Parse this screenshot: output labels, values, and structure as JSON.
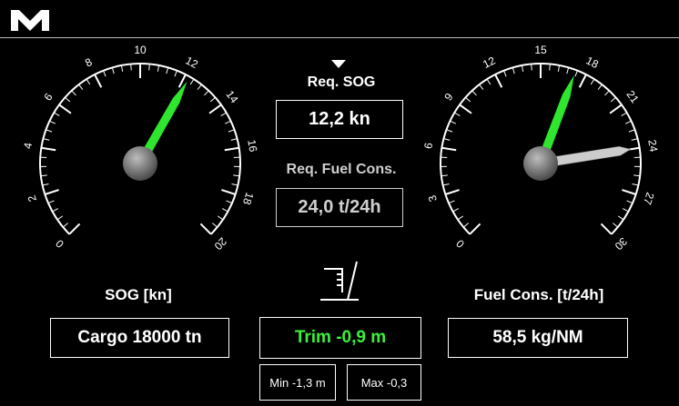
{
  "header": {
    "logo": "M"
  },
  "left_gauge": {
    "title": "SOG [kn]",
    "min": 0,
    "max": 20,
    "major_labels": [
      "0",
      "2",
      "4",
      "6",
      "8",
      "10",
      "12",
      "14",
      "16",
      "18",
      "20"
    ],
    "needle_value": 12.2,
    "needle_color": "#2ee62e"
  },
  "right_gauge": {
    "title": "Fuel Cons. [t/24h]",
    "min": 0,
    "max": 30,
    "major_labels": [
      "0",
      "3",
      "6",
      "9",
      "12",
      "15",
      "18",
      "21",
      "24",
      "27",
      "30"
    ],
    "needle_value": 17.3,
    "needle_color": "#2ee62e",
    "ref_value": 24.0,
    "ref_color": "#cccccc"
  },
  "center": {
    "req_sog_label": "Req. SOG",
    "req_sog_value": "12,2 kn",
    "req_fuel_label": "Req. Fuel Cons.",
    "req_fuel_value": "24,0 t/24h",
    "trim_value": "Trim -0,9 m",
    "trim_color": "#3bf03b",
    "min_value": "Min -1,3 m",
    "max_value": "Max -0,3"
  },
  "bottom": {
    "cargo": "Cargo 18000 tn",
    "consumption": "58,5 kg/NM"
  },
  "colors": {
    "background": "#000000",
    "foreground": "#ffffff",
    "dim_text": "#cfcfcf"
  }
}
